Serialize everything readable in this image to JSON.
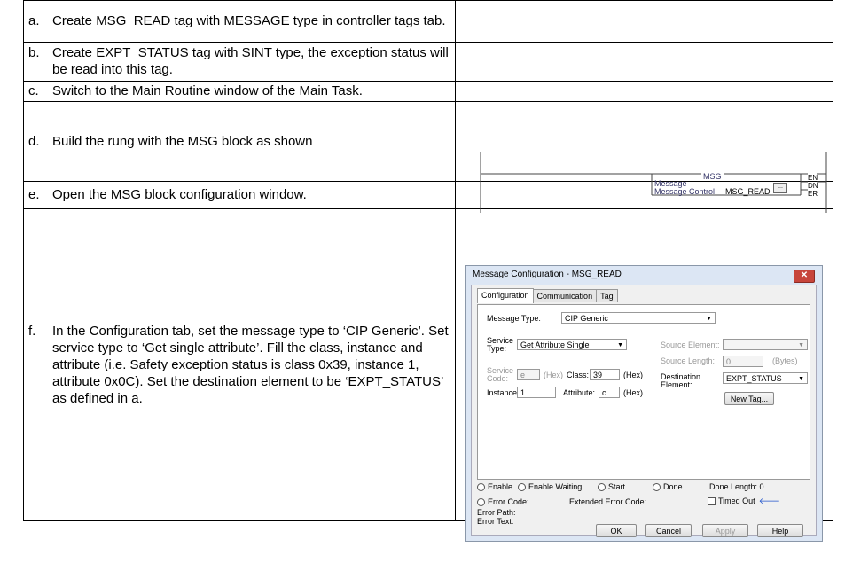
{
  "steps": [
    {
      "label": "a.",
      "text": "Create MSG_READ tag with MESSAGE type in controller tags tab."
    },
    {
      "label": "b.",
      "text": "Create EXPT_STATUS tag with SINT type, the exception status will be read into this tag."
    },
    {
      "label": "c.",
      "text": "Switch to the Main Routine window of the Main Task."
    },
    {
      "label": "d.",
      "text": "Build the rung with the MSG block as shown"
    },
    {
      "label": "e.",
      "text": "Open the MSG block configuration window."
    },
    {
      "label": "f.",
      "text": "In the Configuration tab, set the message type to ‘CIP Generic’. Set service type to ‘Get single attribute’. Fill the class, instance and attribute (i.e. Safety exception status is class 0x39, instance 1, attribute 0x0C). Set the destination element to be ‘EXPT_STATUS’ as defined in a."
    }
  ],
  "rung": {
    "block_title": "MSG",
    "line1": "Message",
    "line2_label": "Message Control",
    "line2_value": "MSG_READ",
    "ellipsis": "...",
    "outputs": [
      "EN",
      "DN",
      "ER"
    ]
  },
  "dialog": {
    "title": "Message Configuration - MSG_READ",
    "close": "✕",
    "tabs": [
      "Configuration",
      "Communication",
      "Tag"
    ],
    "message_type_label": "Message Type:",
    "message_type_value": "CIP Generic",
    "service_type_label": "Service Type:",
    "service_type_value": "Get Attribute Single",
    "service_code_label": "Service Code:",
    "service_code_value": "e",
    "hex": "(Hex)",
    "class_label": "Class:",
    "class_value": "39",
    "instance_label": "Instance:",
    "instance_value": "1",
    "attribute_label": "Attribute:",
    "attribute_value": "c",
    "source_element_label": "Source Element:",
    "source_length_label": "Source Length:",
    "source_length_value": "0",
    "bytes": "(Bytes)",
    "destination_label": "Destination Element:",
    "destination_value": "EXPT_STATUS",
    "new_tag": "New Tag...",
    "status": [
      "Enable",
      "Enable Waiting",
      "Start",
      "Done"
    ],
    "done_length": "Done Length: 0",
    "error_code": "Error Code:",
    "extended_error_code": "Extended Error Code:",
    "timed_out": "Timed Out",
    "error_path": "Error Path:",
    "error_text": "Error Text:",
    "ok": "OK",
    "cancel": "Cancel",
    "apply": "Apply",
    "help": "Help"
  }
}
